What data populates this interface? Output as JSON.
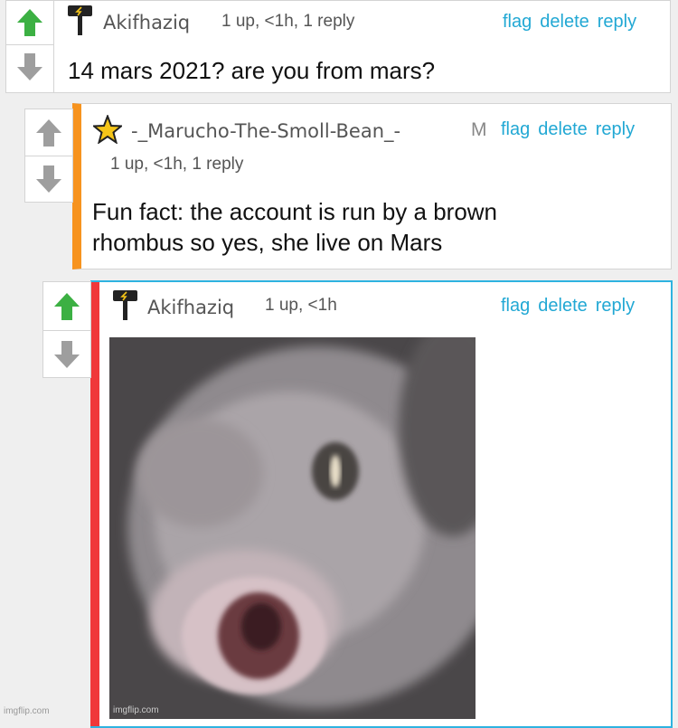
{
  "comments": [
    {
      "username": "Akifhaziq",
      "meta": "1 up, <1h, 1 reply",
      "text": "14 mars 2021? are you from mars?",
      "upvote_active": true
    },
    {
      "username": "-_Marucho-The-Smoll-Bean_-",
      "mod_badge": "M",
      "meta": "1 up, <1h, 1 reply",
      "text_line1": "Fun fact: the account is run by a brown",
      "text_line2": "rhombus so yes, she live on Mars",
      "upvote_active": false,
      "accent_color": "#f7931e"
    },
    {
      "username": "Akifhaziq",
      "meta": "1 up, <1h",
      "upvote_active": true,
      "accent_color": "#f0383a",
      "image_description": "blurry close-up photo of a fish with open mouth",
      "image_watermark": "imgflip.com"
    }
  ],
  "actions": {
    "flag": "flag",
    "delete": "delete",
    "reply": "reply"
  },
  "page_watermark": "imgflip.com",
  "colors": {
    "upvote_active": "#3cb043",
    "arrow_inactive": "#9e9e9e",
    "link": "#22a8d4",
    "selected_border": "#2eb3e0"
  },
  "icons": [
    "upvote-arrow-icon",
    "downvote-arrow-icon",
    "hammer-flair-icon",
    "star-flair-icon"
  ]
}
